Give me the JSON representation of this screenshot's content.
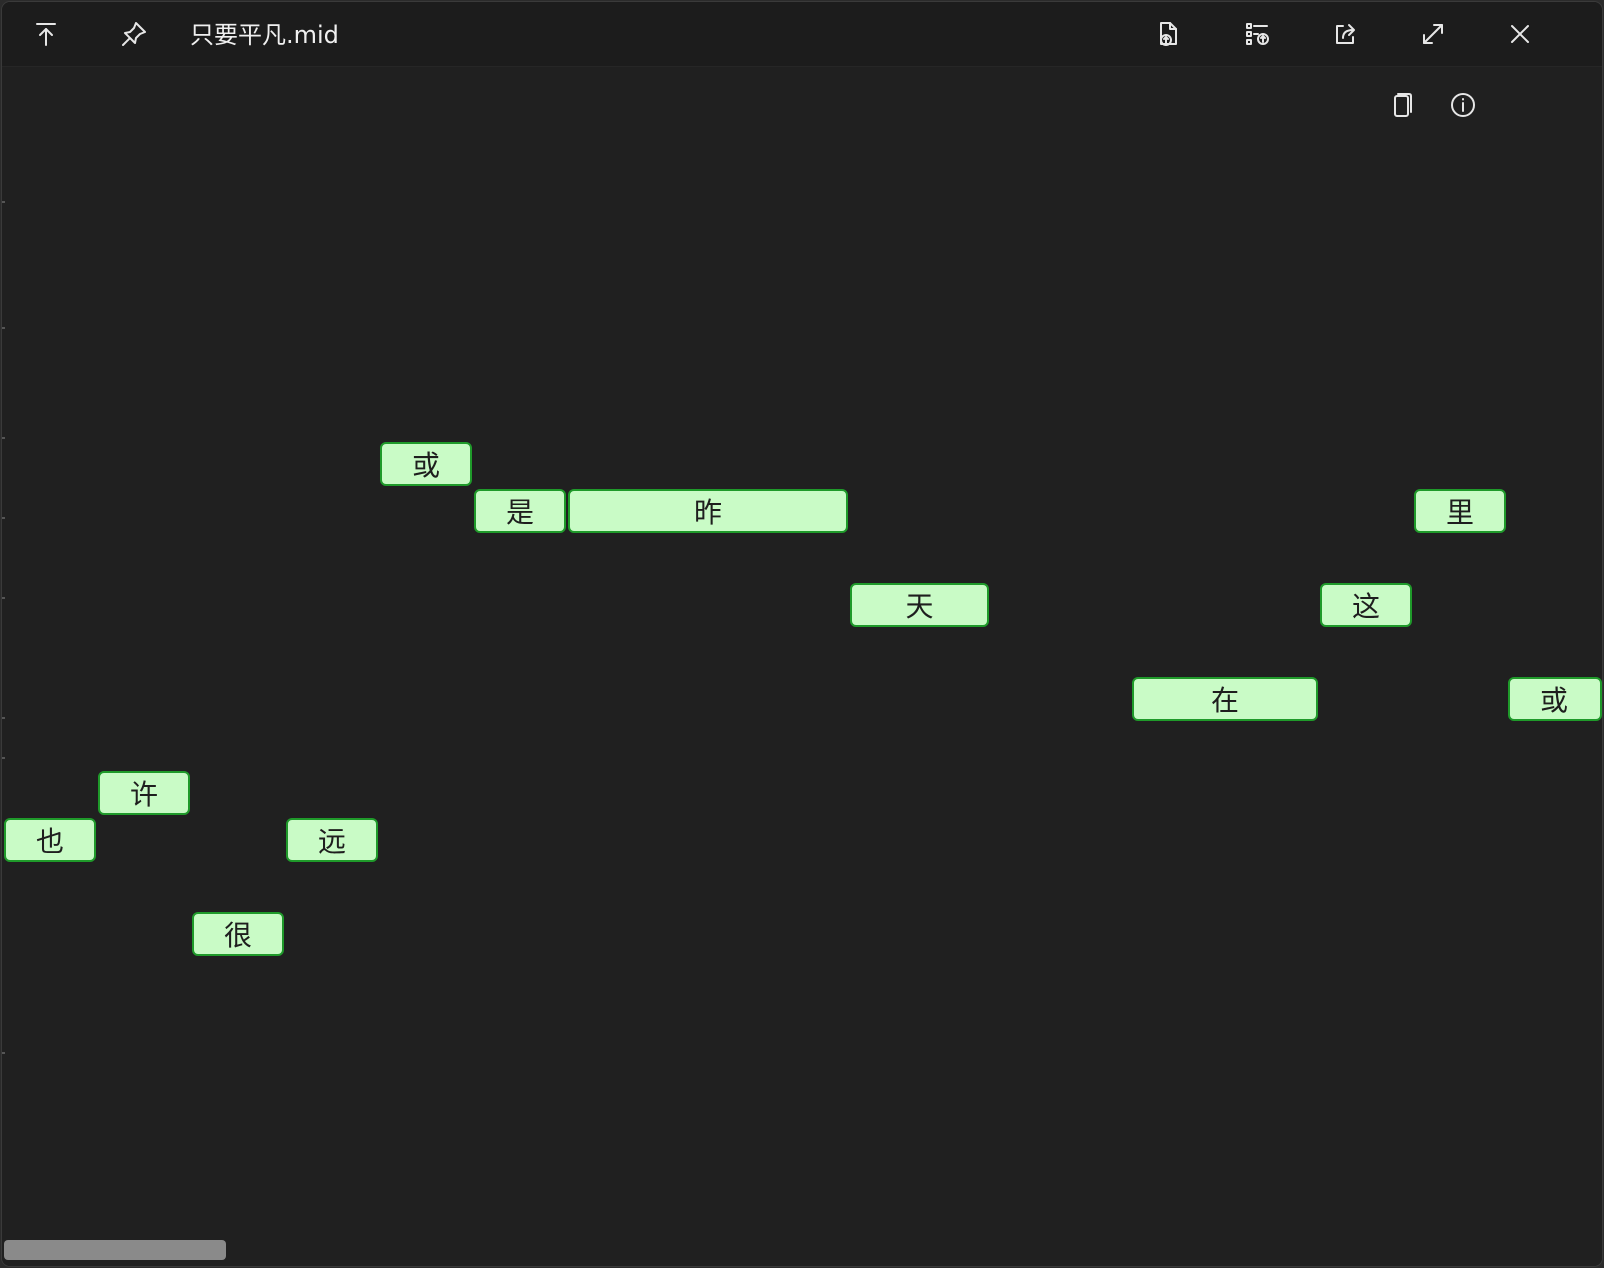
{
  "window": {
    "title": "只要平凡.mid"
  },
  "titlebar": {
    "buttons": [
      {
        "icon": "move-to-top-icon"
      },
      {
        "icon": "pin-icon"
      },
      {
        "icon": "export-file-icon"
      },
      {
        "icon": "export-list-icon"
      },
      {
        "icon": "share-icon"
      },
      {
        "icon": "fullscreen-icon"
      },
      {
        "icon": "close-icon"
      }
    ]
  },
  "toolbar": {
    "buttons": [
      {
        "icon": "copy-icon"
      },
      {
        "icon": "info-icon"
      }
    ]
  },
  "notes": [
    {
      "lyric": "也"
    },
    {
      "lyric": "许"
    },
    {
      "lyric": "很"
    },
    {
      "lyric": "远"
    },
    {
      "lyric": "或"
    },
    {
      "lyric": "是"
    },
    {
      "lyric": "昨"
    },
    {
      "lyric": "天"
    },
    {
      "lyric": "在"
    },
    {
      "lyric": "这"
    },
    {
      "lyric": "里"
    },
    {
      "lyric": "或"
    }
  ],
  "colors": {
    "background": "#202020",
    "note_fill": "#c9fbc6",
    "note_border": "#1f9a2a",
    "titlebar": "#1c1c1c"
  }
}
